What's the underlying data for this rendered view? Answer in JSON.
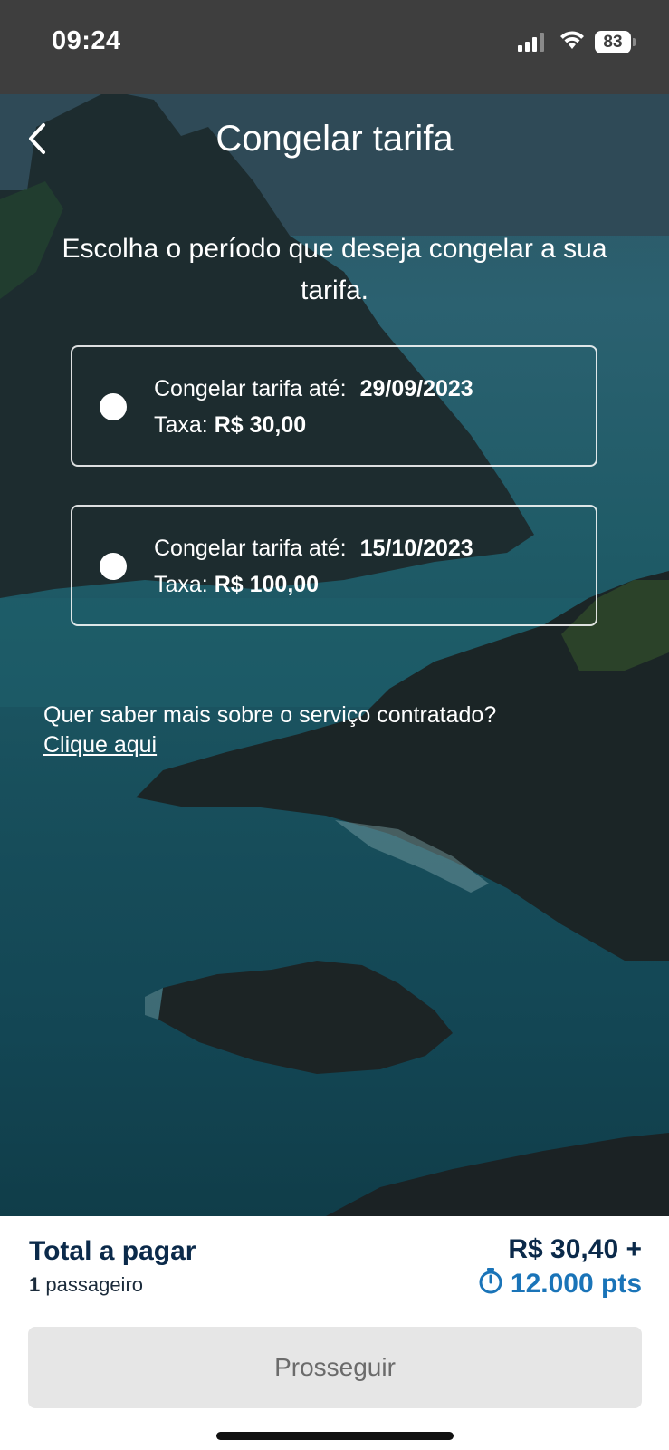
{
  "status_bar": {
    "time": "09:24",
    "battery": "83"
  },
  "header": {
    "title": "Congelar tarifa"
  },
  "instruction": "Escolha o período que deseja congelar a sua tarifa.",
  "options": [
    {
      "label": "Congelar tarifa até:",
      "date": "29/09/2023",
      "fee_label": "Taxa:",
      "fee": "R$ 30,00",
      "selected": false
    },
    {
      "label": "Congelar tarifa até:",
      "date": "15/10/2023",
      "fee_label": "Taxa:",
      "fee": "R$ 100,00",
      "selected": false
    }
  ],
  "info": {
    "question": "Quer saber mais sobre o serviço contratado?",
    "link": "Clique aqui"
  },
  "summary": {
    "total_label": "Total a pagar",
    "passenger_count": "1",
    "passenger_label": "passageiro",
    "amount": "R$ 30,40 +",
    "points": "12.000 pts"
  },
  "actions": {
    "proceed_label": "Prosseguir"
  },
  "colors": {
    "brand_navy": "#0b2a4a",
    "points_blue": "#1a74b8",
    "disabled_button": "#e6e6e6"
  }
}
